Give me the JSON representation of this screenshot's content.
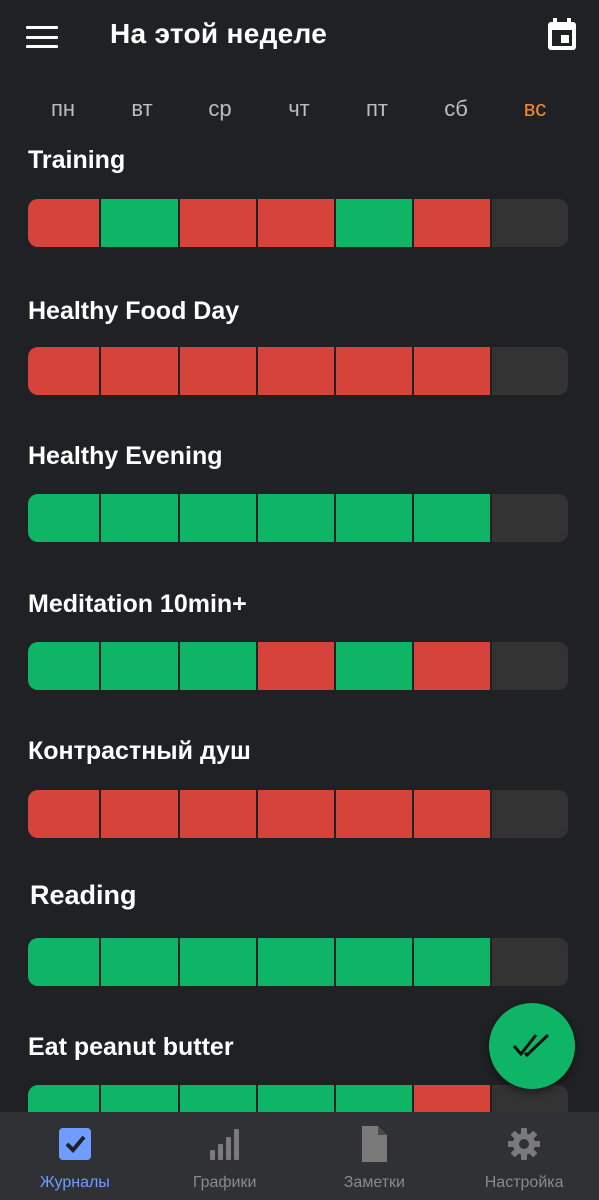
{
  "header": {
    "title": "На этой неделе",
    "menu_icon": "hamburger-menu-icon",
    "calendar_icon": "calendar-icon"
  },
  "weekdays": [
    "пн",
    "вт",
    "ср",
    "чт",
    "пт",
    "сб",
    "вс"
  ],
  "today_index": 6,
  "colors": {
    "done": "#0eb566",
    "missed": "#d5433b",
    "empty": "#333333",
    "accent_today": "#f5892f",
    "nav_active": "#6f9cff"
  },
  "habits": [
    {
      "name": "Training",
      "days": [
        "missed",
        "done",
        "missed",
        "missed",
        "done",
        "missed",
        "empty"
      ]
    },
    {
      "name": "Healthy Food Day",
      "days": [
        "missed",
        "missed",
        "missed",
        "missed",
        "missed",
        "missed",
        "empty"
      ]
    },
    {
      "name": "Healthy Evening",
      "days": [
        "done",
        "done",
        "done",
        "done",
        "done",
        "done",
        "empty"
      ]
    },
    {
      "name": "Meditation 10min+",
      "days": [
        "done",
        "done",
        "done",
        "missed",
        "done",
        "missed",
        "empty"
      ]
    },
    {
      "name": "Контрастный душ",
      "days": [
        "missed",
        "missed",
        "missed",
        "missed",
        "missed",
        "missed",
        "empty"
      ]
    },
    {
      "name": "Reading",
      "days": [
        "done",
        "done",
        "done",
        "done",
        "done",
        "done",
        "empty"
      ]
    },
    {
      "name": "Eat peanut butter",
      "days": [
        "done",
        "done",
        "done",
        "done",
        "done",
        "missed",
        "empty"
      ]
    }
  ],
  "fab": {
    "icon": "double-check-icon"
  },
  "nav": [
    {
      "label": "Журналы",
      "icon": "checkbox-icon",
      "active": true
    },
    {
      "label": "Графики",
      "icon": "bar-chart-icon",
      "active": false
    },
    {
      "label": "Заметки",
      "icon": "note-icon",
      "active": false
    },
    {
      "label": "Настройка",
      "icon": "gear-icon",
      "active": false
    }
  ]
}
